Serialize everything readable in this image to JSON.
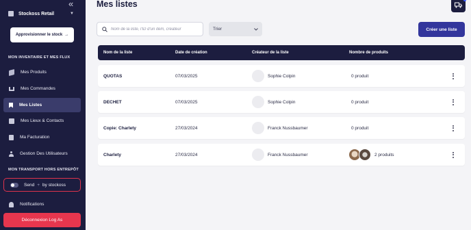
{
  "sidebar": {
    "collapse_glyph": "«",
    "store_name": "Stockoss Retail",
    "restock_label": "Approvisionner le stock",
    "restock_arrow": "→",
    "section_inventory": "MON INVENTAIRE ET MES FLUX",
    "section_transport": "MON TRANSPORT HORS ENTREPÔT",
    "items": [
      {
        "label": "Mes Produits",
        "icon": "cube-icon"
      },
      {
        "label": "Mes Commandes",
        "icon": "cart-icon"
      },
      {
        "label": "Mes Listes",
        "icon": "bookmark-icon",
        "active": true
      },
      {
        "label": "Mes Lieux & Contacts",
        "icon": "truck-icon"
      },
      {
        "label": "Ma Facturation",
        "icon": "document-icon"
      },
      {
        "label": "Gestion Des Utilisateurs",
        "icon": "users-icon"
      }
    ],
    "send_label": "Send",
    "send_plus": "+",
    "send_by": "by stockoss",
    "notifications_label": "Notifications",
    "logout_label": "Déconnexion Log As"
  },
  "header": {
    "title": "Mes listes"
  },
  "toolbar": {
    "search_placeholder": "Nom de la liste, l'ID d'un item, créateur",
    "sort_label": "Trier",
    "create_label": "Créer une liste"
  },
  "table": {
    "columns": [
      "Nom de la liste",
      "Date de création",
      "Créateur de la liste",
      "Nombre de produits"
    ],
    "rows": [
      {
        "name": "QUOTAS",
        "date": "07/03/2025",
        "creator": "Sophie Colpin",
        "count": "0 produit"
      },
      {
        "name": "DECHET",
        "date": "07/03/2025",
        "creator": "Sophie Colpin",
        "count": "0 produit"
      },
      {
        "name": "Copie: Charlety",
        "date": "27/03/2024",
        "creator": "Franck Nussbaumer",
        "count": "0 produit"
      },
      {
        "name": "Charlety",
        "date": "27/03/2024",
        "creator": "Franck Nussbaumer",
        "count": "2 produits"
      }
    ]
  },
  "colors": {
    "sidebar_bg": "#1c1d3f",
    "accent": "#33369c",
    "danger": "#e7364e"
  }
}
